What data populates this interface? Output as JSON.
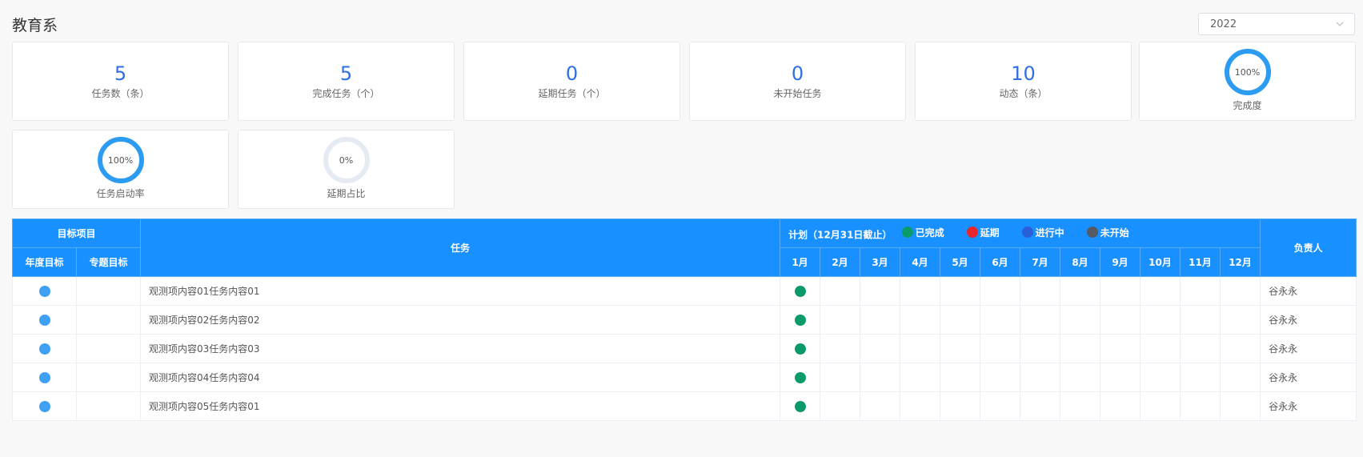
{
  "header": {
    "title": "教育系"
  },
  "year_select": {
    "value": "2022"
  },
  "stats": [
    {
      "value": "5",
      "label": "任务数（条）"
    },
    {
      "value": "5",
      "label": "完成任务（个）"
    },
    {
      "value": "0",
      "label": "延期任务（个）"
    },
    {
      "value": "0",
      "label": "未开始任务"
    },
    {
      "value": "10",
      "label": "动态（条）"
    }
  ],
  "rings": [
    {
      "pct_text": "100%",
      "fraction": 1.0,
      "label": "完成度"
    },
    {
      "pct_text": "100%",
      "fraction": 1.0,
      "label": "任务启动率"
    },
    {
      "pct_text": "0%",
      "fraction": 0.0,
      "label": "延期占比"
    }
  ],
  "colors": {
    "ring": "#2b9cf2",
    "ring_track": "#e6eaf2",
    "header_bg": "#1890ff",
    "accent": "#2f6fe4"
  },
  "table": {
    "group_header": "目标项目",
    "annual_goal": "年度目标",
    "special_goal": "专题目标",
    "task_header": "任务",
    "plan_title": "计划（12月31日截止）",
    "owner_header": "负责人",
    "legend": [
      {
        "label": "已完成",
        "color": "#0b9b6a"
      },
      {
        "label": "延期",
        "color": "#e8262c"
      },
      {
        "label": "进行中",
        "color": "#2a5fd8"
      },
      {
        "label": "未开始",
        "color": "#555a63"
      }
    ],
    "months": [
      "1月",
      "2月",
      "3月",
      "4月",
      "5月",
      "6月",
      "7月",
      "8月",
      "9月",
      "10月",
      "11月",
      "12月"
    ],
    "rows": [
      {
        "task": "观测项内容01任务内容01",
        "owner": "谷永永",
        "annual_dot": "#3fa0f5",
        "status_month": 1,
        "status_color": "#0b9b6a"
      },
      {
        "task": "观测项内容02任务内容02",
        "owner": "谷永永",
        "annual_dot": "#3fa0f5",
        "status_month": 1,
        "status_color": "#0b9b6a"
      },
      {
        "task": "观测项内容03任务内容03",
        "owner": "谷永永",
        "annual_dot": "#3fa0f5",
        "status_month": 1,
        "status_color": "#0b9b6a"
      },
      {
        "task": "观测项内容04任务内容04",
        "owner": "谷永永",
        "annual_dot": "#3fa0f5",
        "status_month": 1,
        "status_color": "#0b9b6a"
      },
      {
        "task": "观测项内容05任务内容01",
        "owner": "谷永永",
        "annual_dot": "#3fa0f5",
        "status_month": 1,
        "status_color": "#0b9b6a"
      }
    ]
  }
}
